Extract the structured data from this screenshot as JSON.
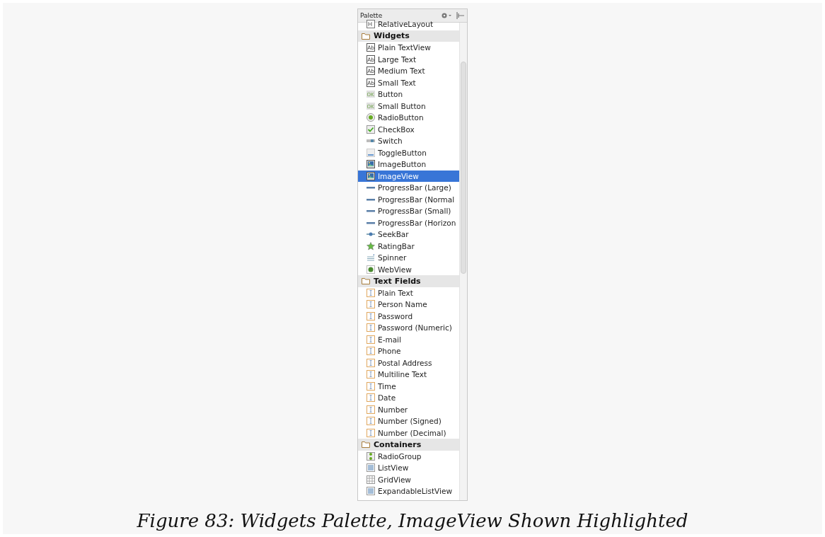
{
  "palette": {
    "title": "Palette",
    "sections": [
      {
        "items": [
          {
            "label": "RelativeLayout",
            "kind": "layout",
            "selected": false
          }
        ]
      },
      {
        "header": "Widgets",
        "items": [
          {
            "label": "Plain TextView",
            "kind": "text",
            "icon_text": "Ab",
            "selected": false
          },
          {
            "label": "Large Text",
            "kind": "text",
            "icon_text": "Ab",
            "selected": false
          },
          {
            "label": "Medium Text",
            "kind": "text",
            "icon_text": "Ab",
            "selected": false
          },
          {
            "label": "Small Text",
            "kind": "text",
            "icon_text": "Ab",
            "selected": false
          },
          {
            "label": "Button",
            "kind": "button",
            "icon_text": "OK",
            "selected": false
          },
          {
            "label": "Small Button",
            "kind": "button",
            "icon_text": "OK",
            "selected": false
          },
          {
            "label": "RadioButton",
            "kind": "radio",
            "selected": false
          },
          {
            "label": "CheckBox",
            "kind": "checkbox",
            "selected": false
          },
          {
            "label": "Switch",
            "kind": "switch",
            "selected": false
          },
          {
            "label": "ToggleButton",
            "kind": "toggle",
            "selected": false
          },
          {
            "label": "ImageButton",
            "kind": "image",
            "selected": false
          },
          {
            "label": "ImageView",
            "kind": "image",
            "selected": true
          },
          {
            "label": "ProgressBar (Large)",
            "kind": "progress",
            "selected": false
          },
          {
            "label": "ProgressBar (Normal",
            "kind": "progress",
            "selected": false
          },
          {
            "label": "ProgressBar (Small)",
            "kind": "progress",
            "selected": false
          },
          {
            "label": "ProgressBar (Horizon",
            "kind": "progress",
            "selected": false
          },
          {
            "label": "SeekBar",
            "kind": "seek",
            "selected": false
          },
          {
            "label": "RatingBar",
            "kind": "rating",
            "selected": false
          },
          {
            "label": "Spinner",
            "kind": "spinner",
            "selected": false
          },
          {
            "label": "WebView",
            "kind": "web",
            "selected": false
          }
        ]
      },
      {
        "header": "Text Fields",
        "items": [
          {
            "label": "Plain Text",
            "kind": "field",
            "selected": false
          },
          {
            "label": "Person Name",
            "kind": "field",
            "selected": false
          },
          {
            "label": "Password",
            "kind": "field",
            "selected": false
          },
          {
            "label": "Password (Numeric)",
            "kind": "field",
            "selected": false
          },
          {
            "label": "E-mail",
            "kind": "field",
            "selected": false
          },
          {
            "label": "Phone",
            "kind": "field",
            "selected": false
          },
          {
            "label": "Postal Address",
            "kind": "field",
            "selected": false
          },
          {
            "label": "Multiline Text",
            "kind": "field",
            "selected": false
          },
          {
            "label": "Time",
            "kind": "field",
            "selected": false
          },
          {
            "label": "Date",
            "kind": "field",
            "selected": false
          },
          {
            "label": "Number",
            "kind": "field",
            "selected": false
          },
          {
            "label": "Number (Signed)",
            "kind": "field",
            "selected": false
          },
          {
            "label": "Number (Decimal)",
            "kind": "field",
            "selected": false
          }
        ]
      },
      {
        "header": "Containers",
        "items": [
          {
            "label": "RadioGroup",
            "kind": "radiogroup",
            "selected": false
          },
          {
            "label": "ListView",
            "kind": "list",
            "selected": false
          },
          {
            "label": "GridView",
            "kind": "grid",
            "selected": false
          },
          {
            "label": "ExpandableListView",
            "kind": "list",
            "selected": false
          }
        ]
      }
    ]
  },
  "caption": "Figure 83: Widgets Palette, ImageView Shown Highlighted"
}
